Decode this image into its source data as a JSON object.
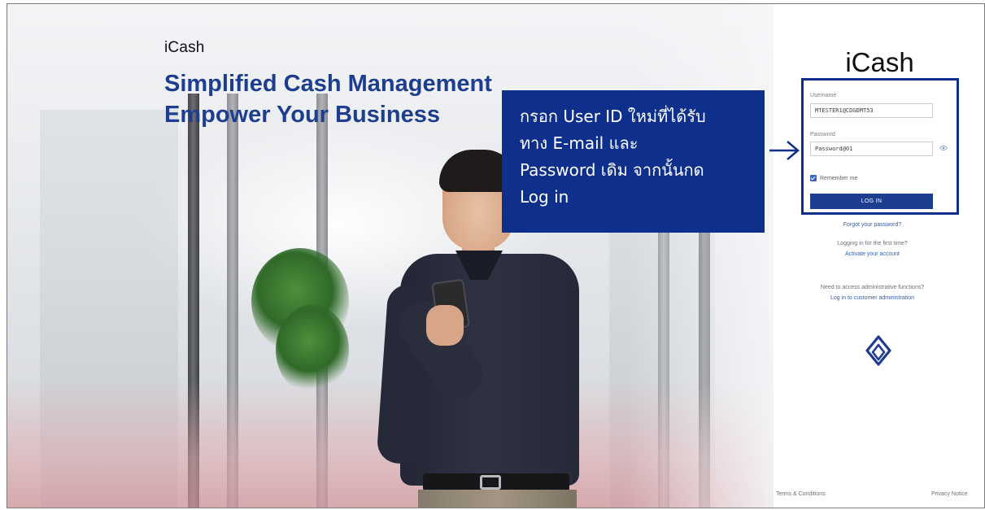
{
  "hero": {
    "brand": "iCash",
    "headline_line1": "Simplified Cash Management",
    "headline_line2": "Empower Your Business"
  },
  "callout": {
    "line1": "กรอก User ID ใหม่ที่ได้รับ",
    "line2": "ทาง E-mail และ",
    "line3": "Password เดิม จากนั้นกด",
    "line4": "Log in"
  },
  "login": {
    "logo": "iCash",
    "username_label": "Username",
    "username_value": "MTESTER1@CDGDMT53",
    "password_label": "Password",
    "password_value": "Password@01",
    "remember_label": "Remember me",
    "remember_checked": true,
    "login_button": "LOG IN",
    "forgot_password": "Forgot your password?",
    "first_time_prompt": "Logging in for the first time?",
    "activate_account": "Activate your account",
    "admin_prompt": "Need to access administrative functions?",
    "admin_link": "Log in to customer administration"
  },
  "footer": {
    "terms": "Terms & Conditions",
    "privacy": "Privacy Notice"
  },
  "icons": {
    "arrow": "right-arrow-icon",
    "eye": "eye-icon",
    "brand_logo": "bangkok-bank-lotus-icon"
  },
  "colors": {
    "brand_blue": "#1d3d8f",
    "callout_blue": "#0f2f8c",
    "link_blue": "#2f5fb8"
  }
}
